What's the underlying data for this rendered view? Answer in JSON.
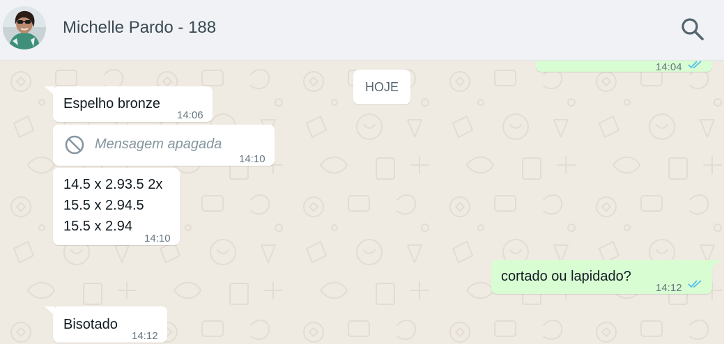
{
  "header": {
    "contact_name": "Michelle Pardo - 188",
    "icons": {
      "search": "search-icon",
      "avatar": "contact-avatar-photo"
    }
  },
  "chat": {
    "date_chip": "HOJE",
    "top_partial_message": {
      "time": "14:04",
      "status": "read"
    },
    "messages": [
      {
        "direction": "in",
        "text": "Espelho bronze",
        "time": "14:06"
      },
      {
        "direction": "in",
        "deleted": true,
        "text": "Mensagem apagada",
        "time": "14:10",
        "icon": "blocked-circle-icon"
      },
      {
        "direction": "in",
        "lines": [
          "14.5 x 2.93.5 2x",
          "15.5 x 2.94.5",
          "15.5 x 2.94"
        ],
        "time": "14:10"
      },
      {
        "direction": "out",
        "text": "cortado ou lapidado?",
        "time": "14:12",
        "status": "read"
      },
      {
        "direction": "in",
        "text": "Bisotado",
        "time": "14:12"
      }
    ]
  },
  "colors": {
    "header_bg": "#f0f2f5",
    "chat_bg": "#efeae2",
    "incoming_bubble": "#ffffff",
    "outgoing_bubble": "#d9fdd3",
    "read_ticks": "#53bdeb",
    "timestamp": "#667781"
  }
}
